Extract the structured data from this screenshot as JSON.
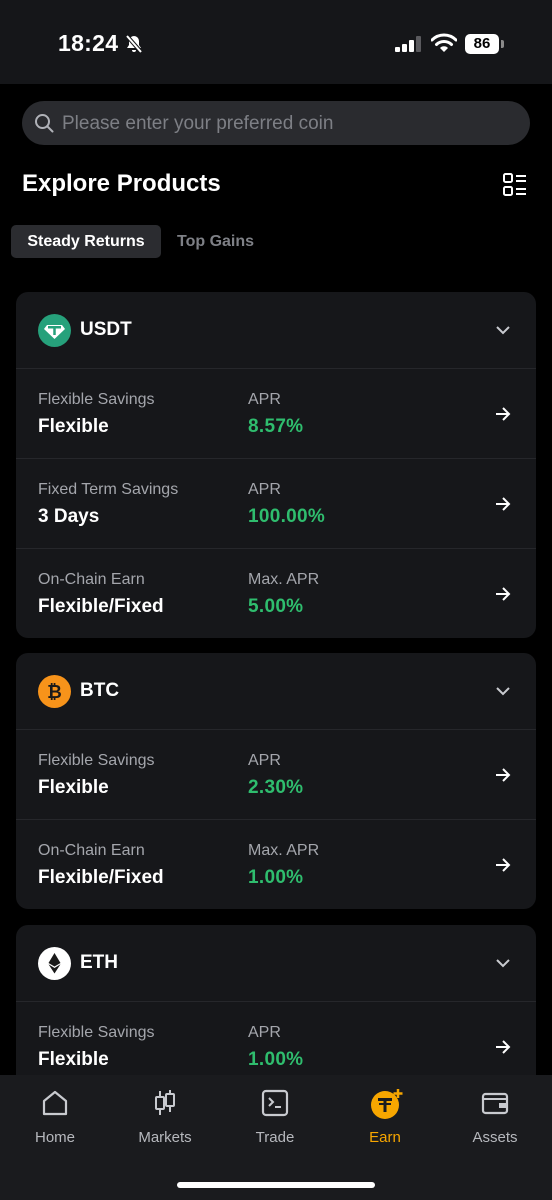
{
  "status": {
    "time": "18:24",
    "battery": "86"
  },
  "search": {
    "placeholder": "Please enter your preferred coin"
  },
  "header": {
    "title": "Explore Products"
  },
  "tabs": [
    {
      "label": "Steady Returns",
      "active": true
    },
    {
      "label": "Top Gains",
      "active": false
    }
  ],
  "cards": [
    {
      "coin": "USDT",
      "rows": [
        {
          "label": "Flexible Savings",
          "value": "Flexible",
          "apr_label": "APR",
          "apr": "8.57%"
        },
        {
          "label": "Fixed Term Savings",
          "value": "3 Days",
          "apr_label": "APR",
          "apr": "100.00%"
        },
        {
          "label": "On-Chain Earn",
          "value": "Flexible/Fixed",
          "apr_label": "Max. APR",
          "apr": "5.00%"
        }
      ]
    },
    {
      "coin": "BTC",
      "rows": [
        {
          "label": "Flexible Savings",
          "value": "Flexible",
          "apr_label": "APR",
          "apr": "2.30%"
        },
        {
          "label": "On-Chain Earn",
          "value": "Flexible/Fixed",
          "apr_label": "Max. APR",
          "apr": "1.00%"
        }
      ]
    },
    {
      "coin": "ETH",
      "rows": [
        {
          "label": "Flexible Savings",
          "value": "Flexible",
          "apr_label": "APR",
          "apr": "1.00%"
        }
      ]
    }
  ],
  "nav": [
    {
      "label": "Home",
      "icon": "home-icon"
    },
    {
      "label": "Markets",
      "icon": "candlestick-icon"
    },
    {
      "label": "Trade",
      "icon": "trade-icon"
    },
    {
      "label": "Earn",
      "icon": "earn-icon",
      "active": true
    },
    {
      "label": "Assets",
      "icon": "wallet-icon"
    }
  ],
  "colors": {
    "accent": "#f7a600",
    "positive": "#2fbd6e",
    "usdt": "#26a17b",
    "btc": "#f7931a"
  }
}
